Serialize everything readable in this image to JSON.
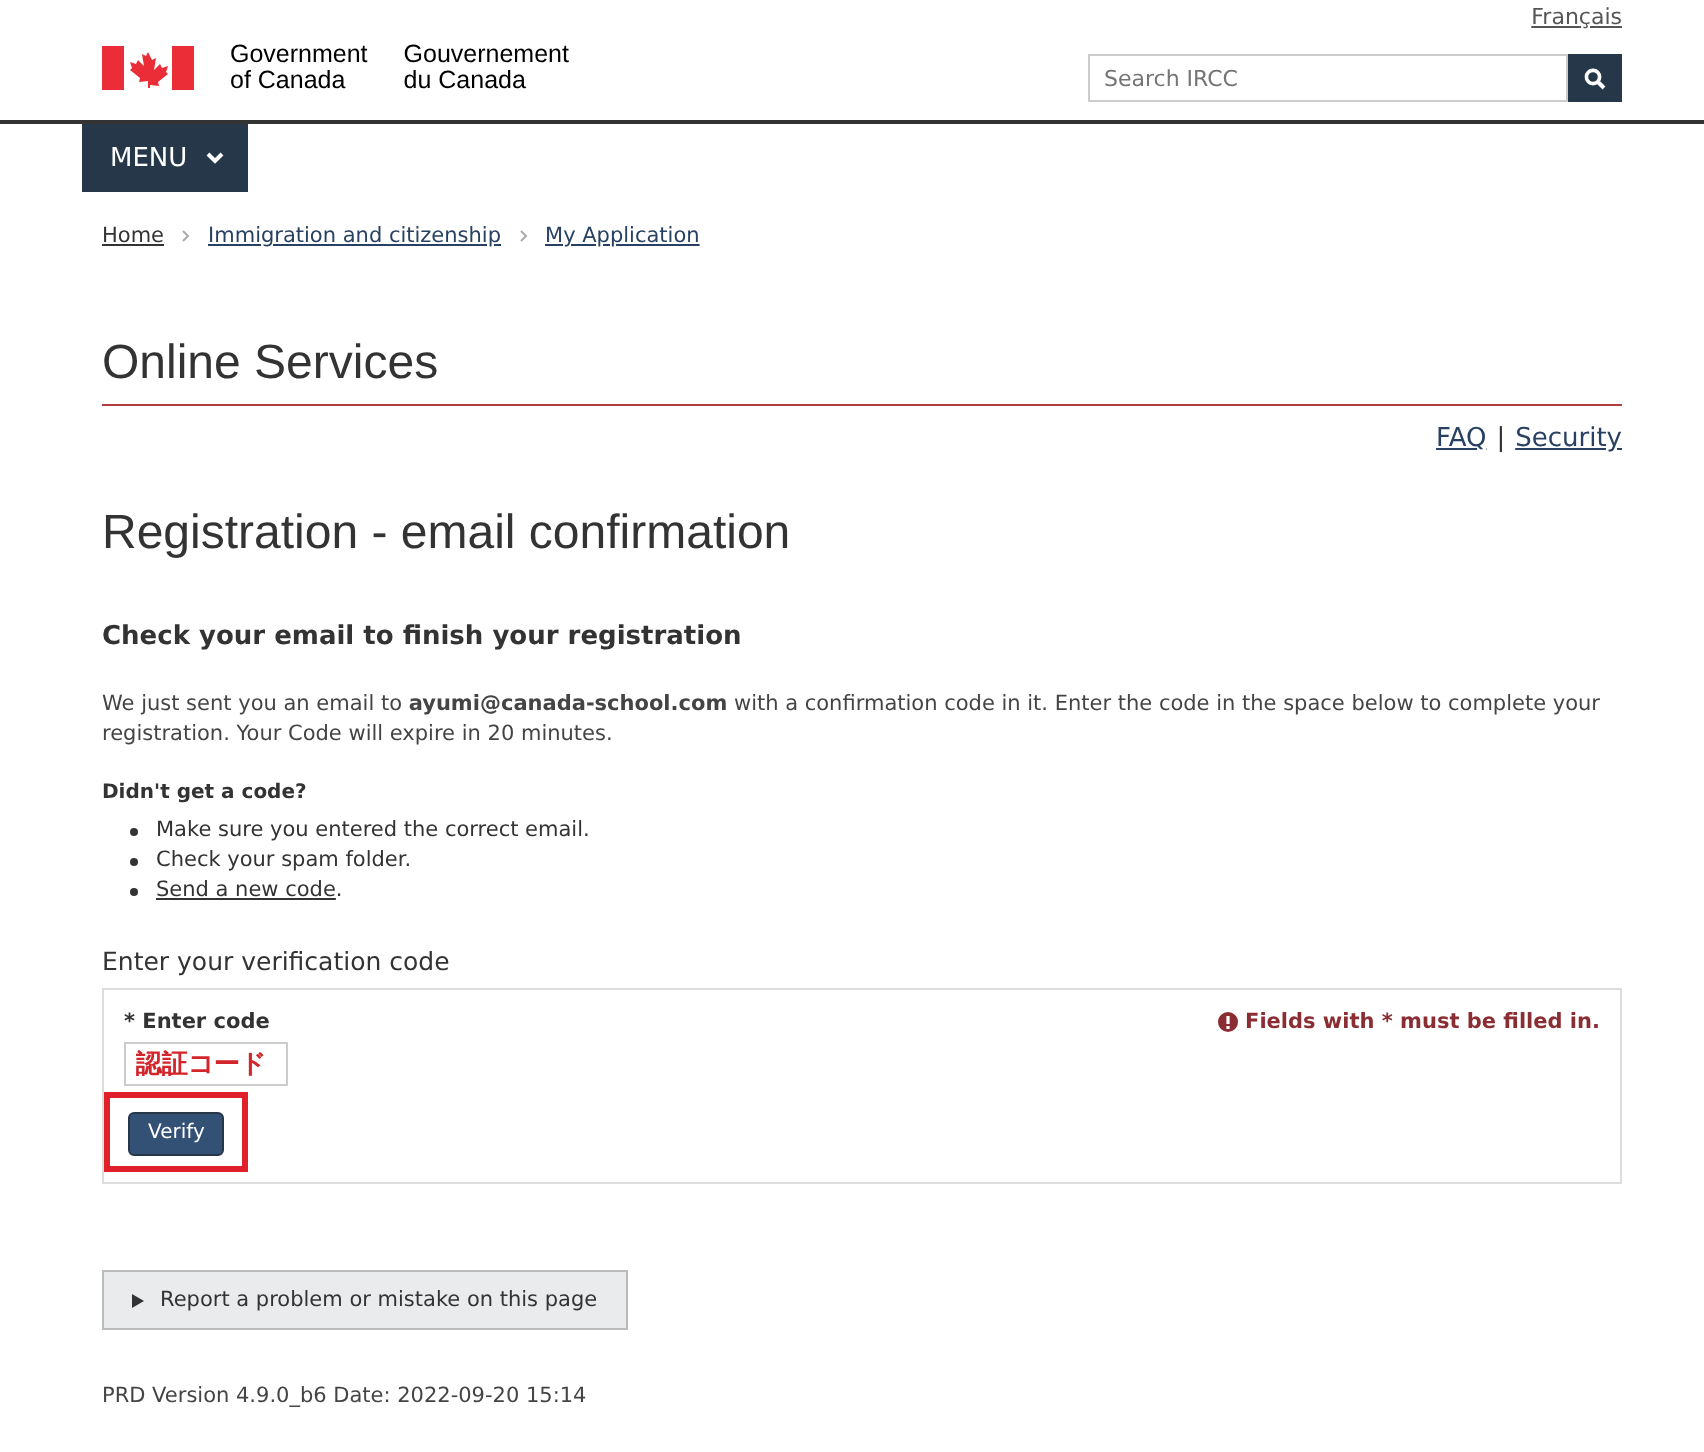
{
  "header": {
    "language_link": "Français",
    "government_en": [
      "Government",
      "of Canada"
    ],
    "government_fr": [
      "Gouvernement",
      "du Canada"
    ],
    "search": {
      "placeholder": "Search IRCC"
    }
  },
  "menu": {
    "label": "MENU"
  },
  "breadcrumbs": [
    "Home",
    "Immigration and citizenship",
    "My Application"
  ],
  "site_title": "Online Services",
  "utility_links": [
    "FAQ",
    "Security"
  ],
  "utility_separator": "|",
  "page_title": "Registration - email confirmation",
  "section_heading": "Check your email to finish your registration",
  "intro": "We just sent you an email to **ayumi@canada-school.com** with a confirmation code in it. Enter the code in the space below to complete your registration. Your Code will expire in 20 minutes.",
  "no_code": {
    "heading": "Didn't get a code?",
    "items": [
      {
        "text": "Make sure you entered the correct email.",
        "kind": "text"
      },
      {
        "text": "Check your spam folder.",
        "kind": "text"
      },
      {
        "text": "Send a new code",
        "kind": "link",
        "suffix": "."
      }
    ]
  },
  "form": {
    "heading": "Enter your verification code",
    "field_label": "* Enter code",
    "required_note": "Fields with * must be filled in.",
    "code_value": "認証コード",
    "button": "Verify",
    "button_highlighted": true
  },
  "report_button": "Report a problem or mistake on this page",
  "version": "PRD Version 4.9.0_b6 Date: 2022-09-20 15:14"
}
